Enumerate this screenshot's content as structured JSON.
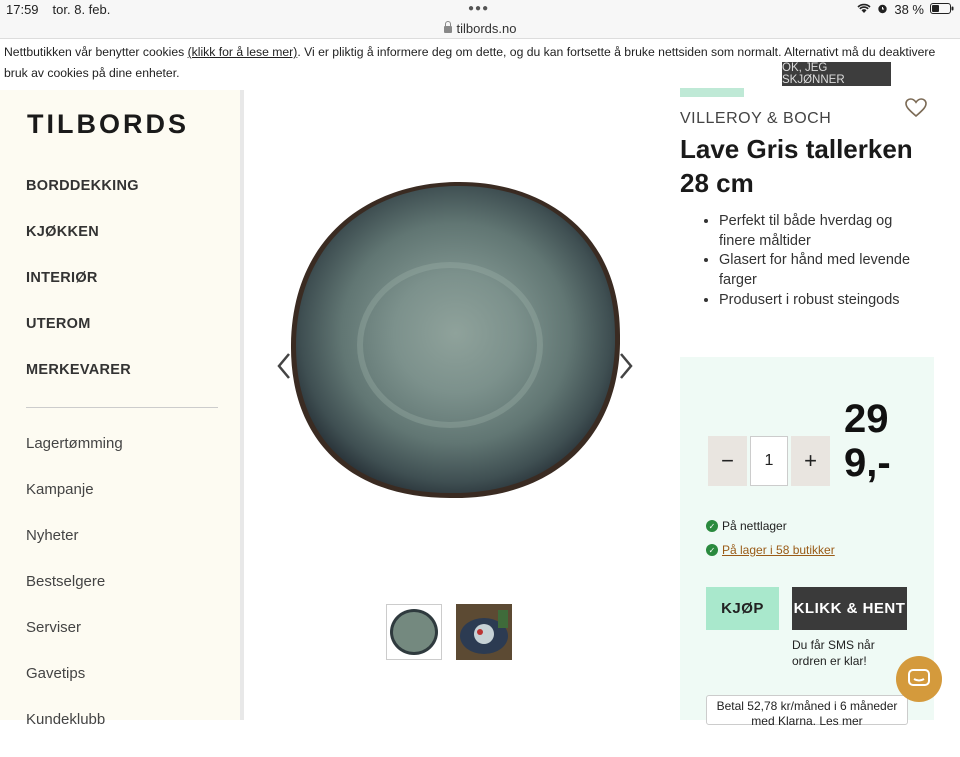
{
  "statusbar": {
    "time": "17:59",
    "date": "tor. 8. feb.",
    "battery": "38 %"
  },
  "browser": {
    "url": "tilbords.no"
  },
  "cookie": {
    "text_before": "Nettbutikken vår benytter cookies ",
    "link": "(klikk for å lese mer)",
    "text_after": ". Vi er pliktig å informere deg om dette, og du kan fortsette å bruke nettsiden som normalt. Alternativt må du deaktivere bruk av cookies på dine enheter.",
    "accept_label": "OK, JEG SKJØNNER"
  },
  "logo": "TILBORDS",
  "nav": {
    "main": [
      "BORDDEKKING",
      "KJØKKEN",
      "INTERIØR",
      "UTEROM",
      "MERKEVARER"
    ],
    "secondary": [
      "Lagertømming",
      "Kampanje",
      "Nyheter",
      "Bestselgere",
      "Serviser",
      "Gavetips",
      "Kundeklubb"
    ]
  },
  "product": {
    "brand": "VILLEROY & BOCH",
    "title": "Lave Gris tallerken 28 cm",
    "bullets": [
      "Perfekt til både hverdag og finere måltider",
      "Glasert for hånd med levende farger",
      "Produsert i robust steingods"
    ],
    "quantity": "1",
    "price_line1": "29",
    "price_line2": "9,-",
    "stock_online": "På nettlager",
    "stock_stores": "På lager i 58 butikker",
    "buy_label": "KJØP",
    "pickup_label": "KLIKK & HENT",
    "sms_note": "Du får SMS når ordren er klar!",
    "klarna_text": "Betal 52,78 kr/måned i 6 måneder med Klarna. Les mer"
  },
  "icons": {
    "heart": "heart-icon",
    "prev": "chevron-left-icon",
    "next": "chevron-right-icon",
    "check": "check-circle-icon",
    "chat": "chat-icon",
    "lock": "lock-icon",
    "wifi": "wifi-icon",
    "alarm": "alarm-icon",
    "battery": "battery-icon"
  },
  "colors": {
    "accent_mint": "#a9e8cc",
    "buybox_bg": "#effaf5",
    "sidebar_bg": "#fdfbf2",
    "chat": "#d49a3c",
    "link_brown": "#9a5b17"
  }
}
